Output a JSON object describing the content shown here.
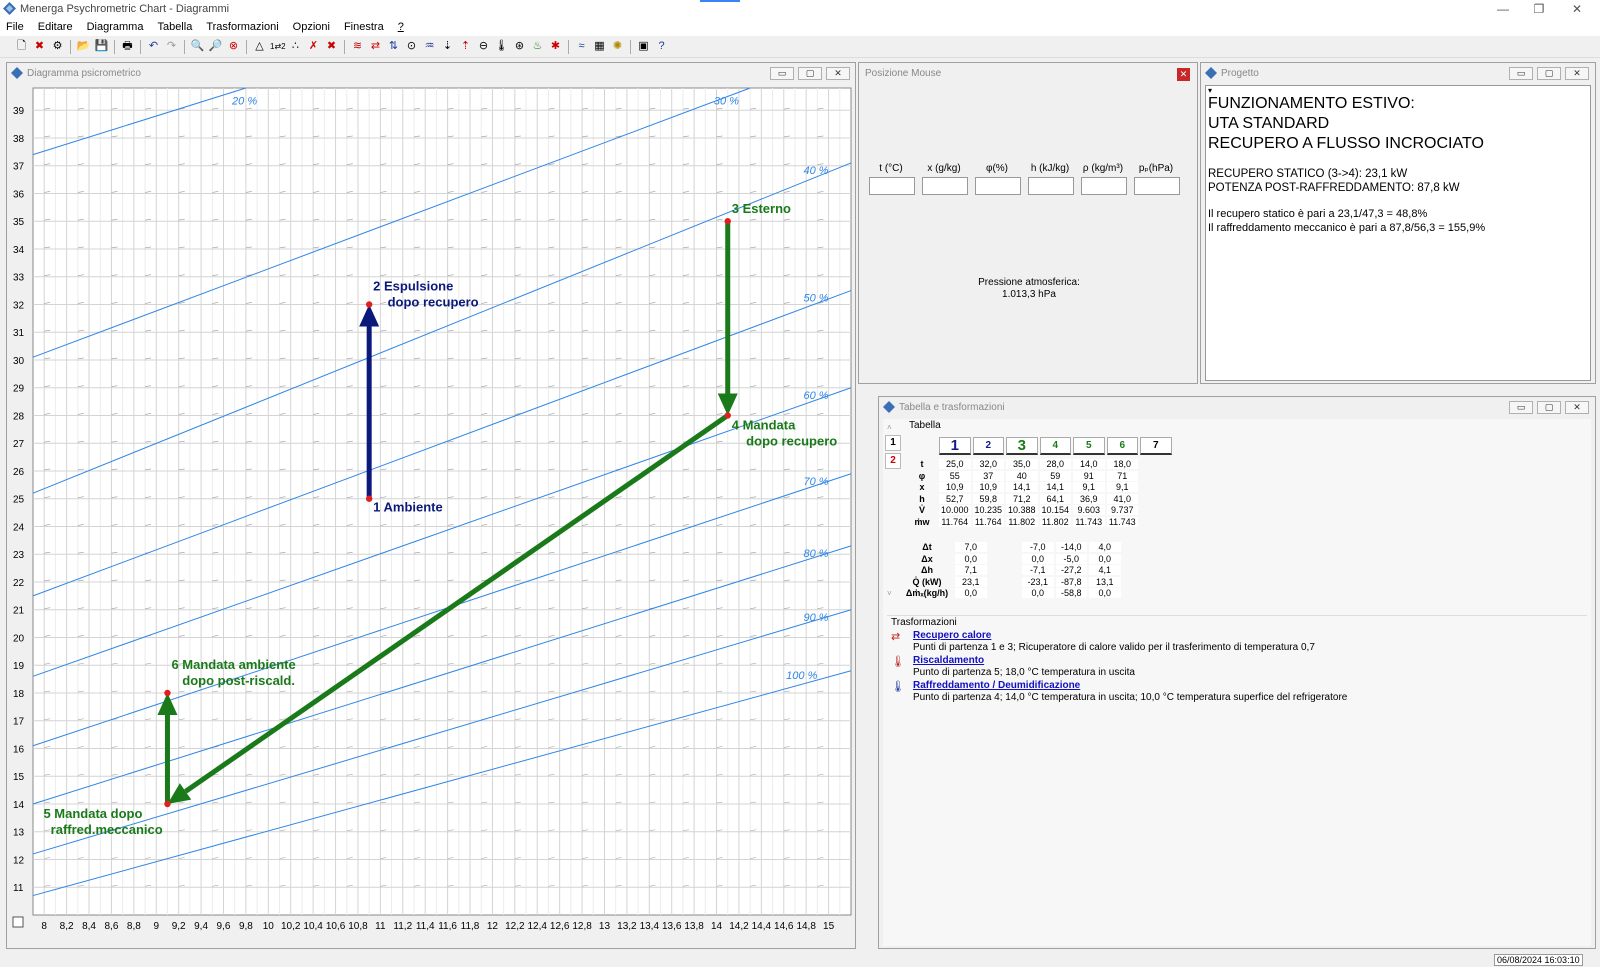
{
  "window": {
    "title": "Menerga Psychrometric Chart  -  Diagrammi",
    "minimize": "—",
    "maximize": "❐",
    "close": "✕"
  },
  "menu": [
    "File",
    "Editare",
    "Diagramma",
    "Tabella",
    "Trasformazioni",
    "Opzioni",
    "Finestra",
    "?"
  ],
  "diagram_window": {
    "title": "Diagramma psicrometrico"
  },
  "mouse_window": {
    "title": "Posizione Mouse",
    "fields": [
      "t (°C)",
      "x (g/kg)",
      "φ(%)",
      "h (kJ/kg)",
      "ρ (kg/m³)",
      "pₚ(hPa)"
    ],
    "pressure_label": "Pressione atmosferica:",
    "pressure_value": "1.013,3 hPa"
  },
  "project_window": {
    "title": "Progetto",
    "heading_lines": [
      "FUNZIONAMENTO ESTIVO:",
      "UTA STANDARD",
      "RECUPERO A FLUSSO INCROCIATO"
    ],
    "info_lines_1": [
      "RECUPERO STATICO (3->4): 23,1 kW",
      "POTENZA POST-RAFFREDDAMENTO:  87,8 kW"
    ],
    "info_lines_2": [
      "Il recupero statico è pari a 23,1/47,3 = 48,8%",
      "Il raffreddamento meccanico è pari a 87,8/56,3 = 155,9%"
    ]
  },
  "table_window": {
    "title": "Tabella e trasformazioni",
    "tabella_label": "Tabella",
    "side_tabs": [
      "1",
      "2"
    ],
    "col_headers": [
      "1",
      "2",
      "3",
      "4",
      "5",
      "6",
      "7"
    ],
    "rows": [
      {
        "label": "t",
        "values": [
          "25,0",
          "32,0",
          "35,0",
          "28,0",
          "14,0",
          "18,0",
          ""
        ]
      },
      {
        "label": "φ",
        "values": [
          "55",
          "37",
          "40",
          "59",
          "91",
          "71",
          ""
        ]
      },
      {
        "label": "x",
        "values": [
          "10,9",
          "10,9",
          "14,1",
          "14,1",
          "9,1",
          "9,1",
          ""
        ]
      },
      {
        "label": "h",
        "values": [
          "52,7",
          "59,8",
          "71,2",
          "64,1",
          "36,9",
          "41,0",
          ""
        ]
      },
      {
        "label": "V̇",
        "values": [
          "10.000",
          "10.235",
          "10.388",
          "10.154",
          "9.603",
          "9.737",
          ""
        ]
      },
      {
        "label": "ṁw",
        "values": [
          "11.764",
          "11.764",
          "11.802",
          "11.802",
          "11.743",
          "11.743",
          ""
        ]
      }
    ],
    "delta_rows": [
      {
        "label": "Δt",
        "values": [
          "7,0",
          "",
          "-7,0",
          "-14,0",
          "4,0",
          ""
        ]
      },
      {
        "label": "Δx",
        "values": [
          "0,0",
          "",
          "0,0",
          "-5,0",
          "0,0",
          ""
        ]
      },
      {
        "label": "Δh",
        "values": [
          "7,1",
          "",
          "-7,1",
          "-27,2",
          "4,1",
          ""
        ]
      },
      {
        "label": "Q̇ (kW)",
        "values": [
          "23,1",
          "",
          "-23,1",
          "-87,8",
          "13,1",
          ""
        ]
      },
      {
        "label": "Δṁₓ(kg/h)",
        "values": [
          "0,0",
          "",
          "0,0",
          "-58,8",
          "0,0",
          ""
        ]
      }
    ],
    "trasformazioni_label": "Trasformazioni",
    "transformations": [
      {
        "title": "Recupero calore",
        "desc": "Punti di partenza 1 e 3; Ricuperatore di calore valido per il trasferimento di temperatura 0,7"
      },
      {
        "title": "Riscaldamento",
        "desc": "Punto di partenza 5; 18,0 °C temperatura in uscita"
      },
      {
        "title": "Raffreddamento / Deumidificazione",
        "desc": "Punto di partenza 4; 14,0 °C temperatura in uscita; 10,0 °C temperatura superfice del refrigeratore"
      }
    ]
  },
  "status": {
    "datetime": "06/08/2024 16:03:10"
  },
  "chart_data": {
    "type": "line",
    "x_axis": {
      "min": 7.9,
      "max": 15.2,
      "ticks": [
        8,
        8.2,
        8.4,
        8.6,
        8.8,
        9,
        9.2,
        9.4,
        9.6,
        9.8,
        10,
        10.2,
        10.4,
        10.6,
        10.8,
        11,
        11.2,
        11.4,
        11.6,
        11.8,
        12,
        12.2,
        12.4,
        12.6,
        12.8,
        13,
        13.2,
        13.4,
        13.6,
        13.8,
        14,
        14.2,
        14.4,
        14.6,
        14.8,
        15
      ]
    },
    "y_axis": {
      "min": 10,
      "max": 39.8,
      "ticks": [
        11,
        12,
        13,
        14,
        15,
        16,
        17,
        18,
        19,
        20,
        21,
        22,
        23,
        24,
        25,
        26,
        27,
        28,
        29,
        30,
        31,
        32,
        33,
        34,
        35,
        36,
        37,
        38,
        39
      ]
    },
    "x_tick_labels": [
      "8",
      "8,2",
      "8,4",
      "8,6",
      "8,8",
      "9",
      "9,2",
      "9,4",
      "9,6",
      "9,8",
      "10",
      "10,2",
      "10,4",
      "10,6",
      "10,8",
      "11",
      "11,2",
      "11,4",
      "11,6",
      "11,8",
      "12",
      "12,2",
      "12,4",
      "12,6",
      "12,8",
      "13",
      "13,2",
      "13,4",
      "13,6",
      "13,8",
      "14",
      "14,2",
      "14,4",
      "14,6",
      "14,8",
      "15"
    ],
    "rh_curves": [
      {
        "label": "20 %",
        "x0": 7.9,
        "y0": 37.4,
        "x1": 9.8,
        "y1": 39.8,
        "label_x": 9.9,
        "label_y": 39.2
      },
      {
        "label": "30 %",
        "x0": 7.9,
        "y0": 30.1,
        "x1": 14.3,
        "y1": 39.8,
        "label_x": 14.2,
        "label_y": 39.2
      },
      {
        "label": "40 %",
        "x0": 7.9,
        "y0": 25.2,
        "x1": 15.2,
        "y1": 37.1,
        "label_x": 15.0,
        "label_y": 36.7
      },
      {
        "label": "50 %",
        "x0": 7.9,
        "y0": 21.5,
        "x1": 15.2,
        "y1": 32.5,
        "label_x": 15.0,
        "label_y": 32.1
      },
      {
        "label": "60 %",
        "x0": 7.9,
        "y0": 18.6,
        "x1": 15.2,
        "y1": 29.0,
        "label_x": 15.0,
        "label_y": 28.6
      },
      {
        "label": "70 %",
        "x0": 7.9,
        "y0": 16.1,
        "x1": 15.2,
        "y1": 25.9,
        "label_x": 15.0,
        "label_y": 25.5
      },
      {
        "label": "80 %",
        "x0": 7.9,
        "y0": 14.0,
        "x1": 15.2,
        "y1": 23.3,
        "label_x": 15.0,
        "label_y": 22.9
      },
      {
        "label": "90 %",
        "x0": 7.9,
        "y0": 12.2,
        "x1": 15.2,
        "y1": 21.0,
        "label_x": 15.0,
        "label_y": 20.6
      },
      {
        "label": "100 %",
        "x0": 7.9,
        "y0": 10.7,
        "x1": 15.2,
        "y1": 18.8,
        "label_x": 14.9,
        "label_y": 18.5
      }
    ],
    "points": [
      {
        "id": "1",
        "x": 10.9,
        "y": 25.0,
        "label_lines": [
          "1 Ambiente"
        ],
        "color": "#0b1a7a"
      },
      {
        "id": "2",
        "x": 10.9,
        "y": 32.0,
        "label_lines": [
          "2 Espulsione",
          "    dopo recupero"
        ],
        "color": "#0b1a7a"
      },
      {
        "id": "3",
        "x": 14.1,
        "y": 35.0,
        "label_lines": [
          "3 Esterno"
        ],
        "color": "#1a7a1a"
      },
      {
        "id": "4",
        "x": 14.1,
        "y": 28.0,
        "label_lines": [
          "4 Mandata",
          "    dopo recupero"
        ],
        "color": "#1a7a1a"
      },
      {
        "id": "5",
        "x": 9.1,
        "y": 14.0,
        "label_lines": [
          "5 Mandata dopo",
          "  raffred.meccanico"
        ],
        "color": "#1a7a1a"
      },
      {
        "id": "6",
        "x": 9.1,
        "y": 18.0,
        "label_lines": [
          "6 Mandata ambiente",
          "   dopo post-riscald."
        ],
        "color": "#1a7a1a"
      }
    ],
    "processes": [
      {
        "from": "1",
        "to": "2",
        "color": "#0b1a7a"
      },
      {
        "from": "3",
        "to": "4",
        "color": "#1a7a1a"
      },
      {
        "from": "4",
        "to": "5",
        "color": "#1a7a1a"
      },
      {
        "from": "5",
        "to": "6",
        "color": "#1a7a1a"
      }
    ],
    "grid": true,
    "curve_color": "#2f86e6",
    "point_color": "#e02020"
  }
}
